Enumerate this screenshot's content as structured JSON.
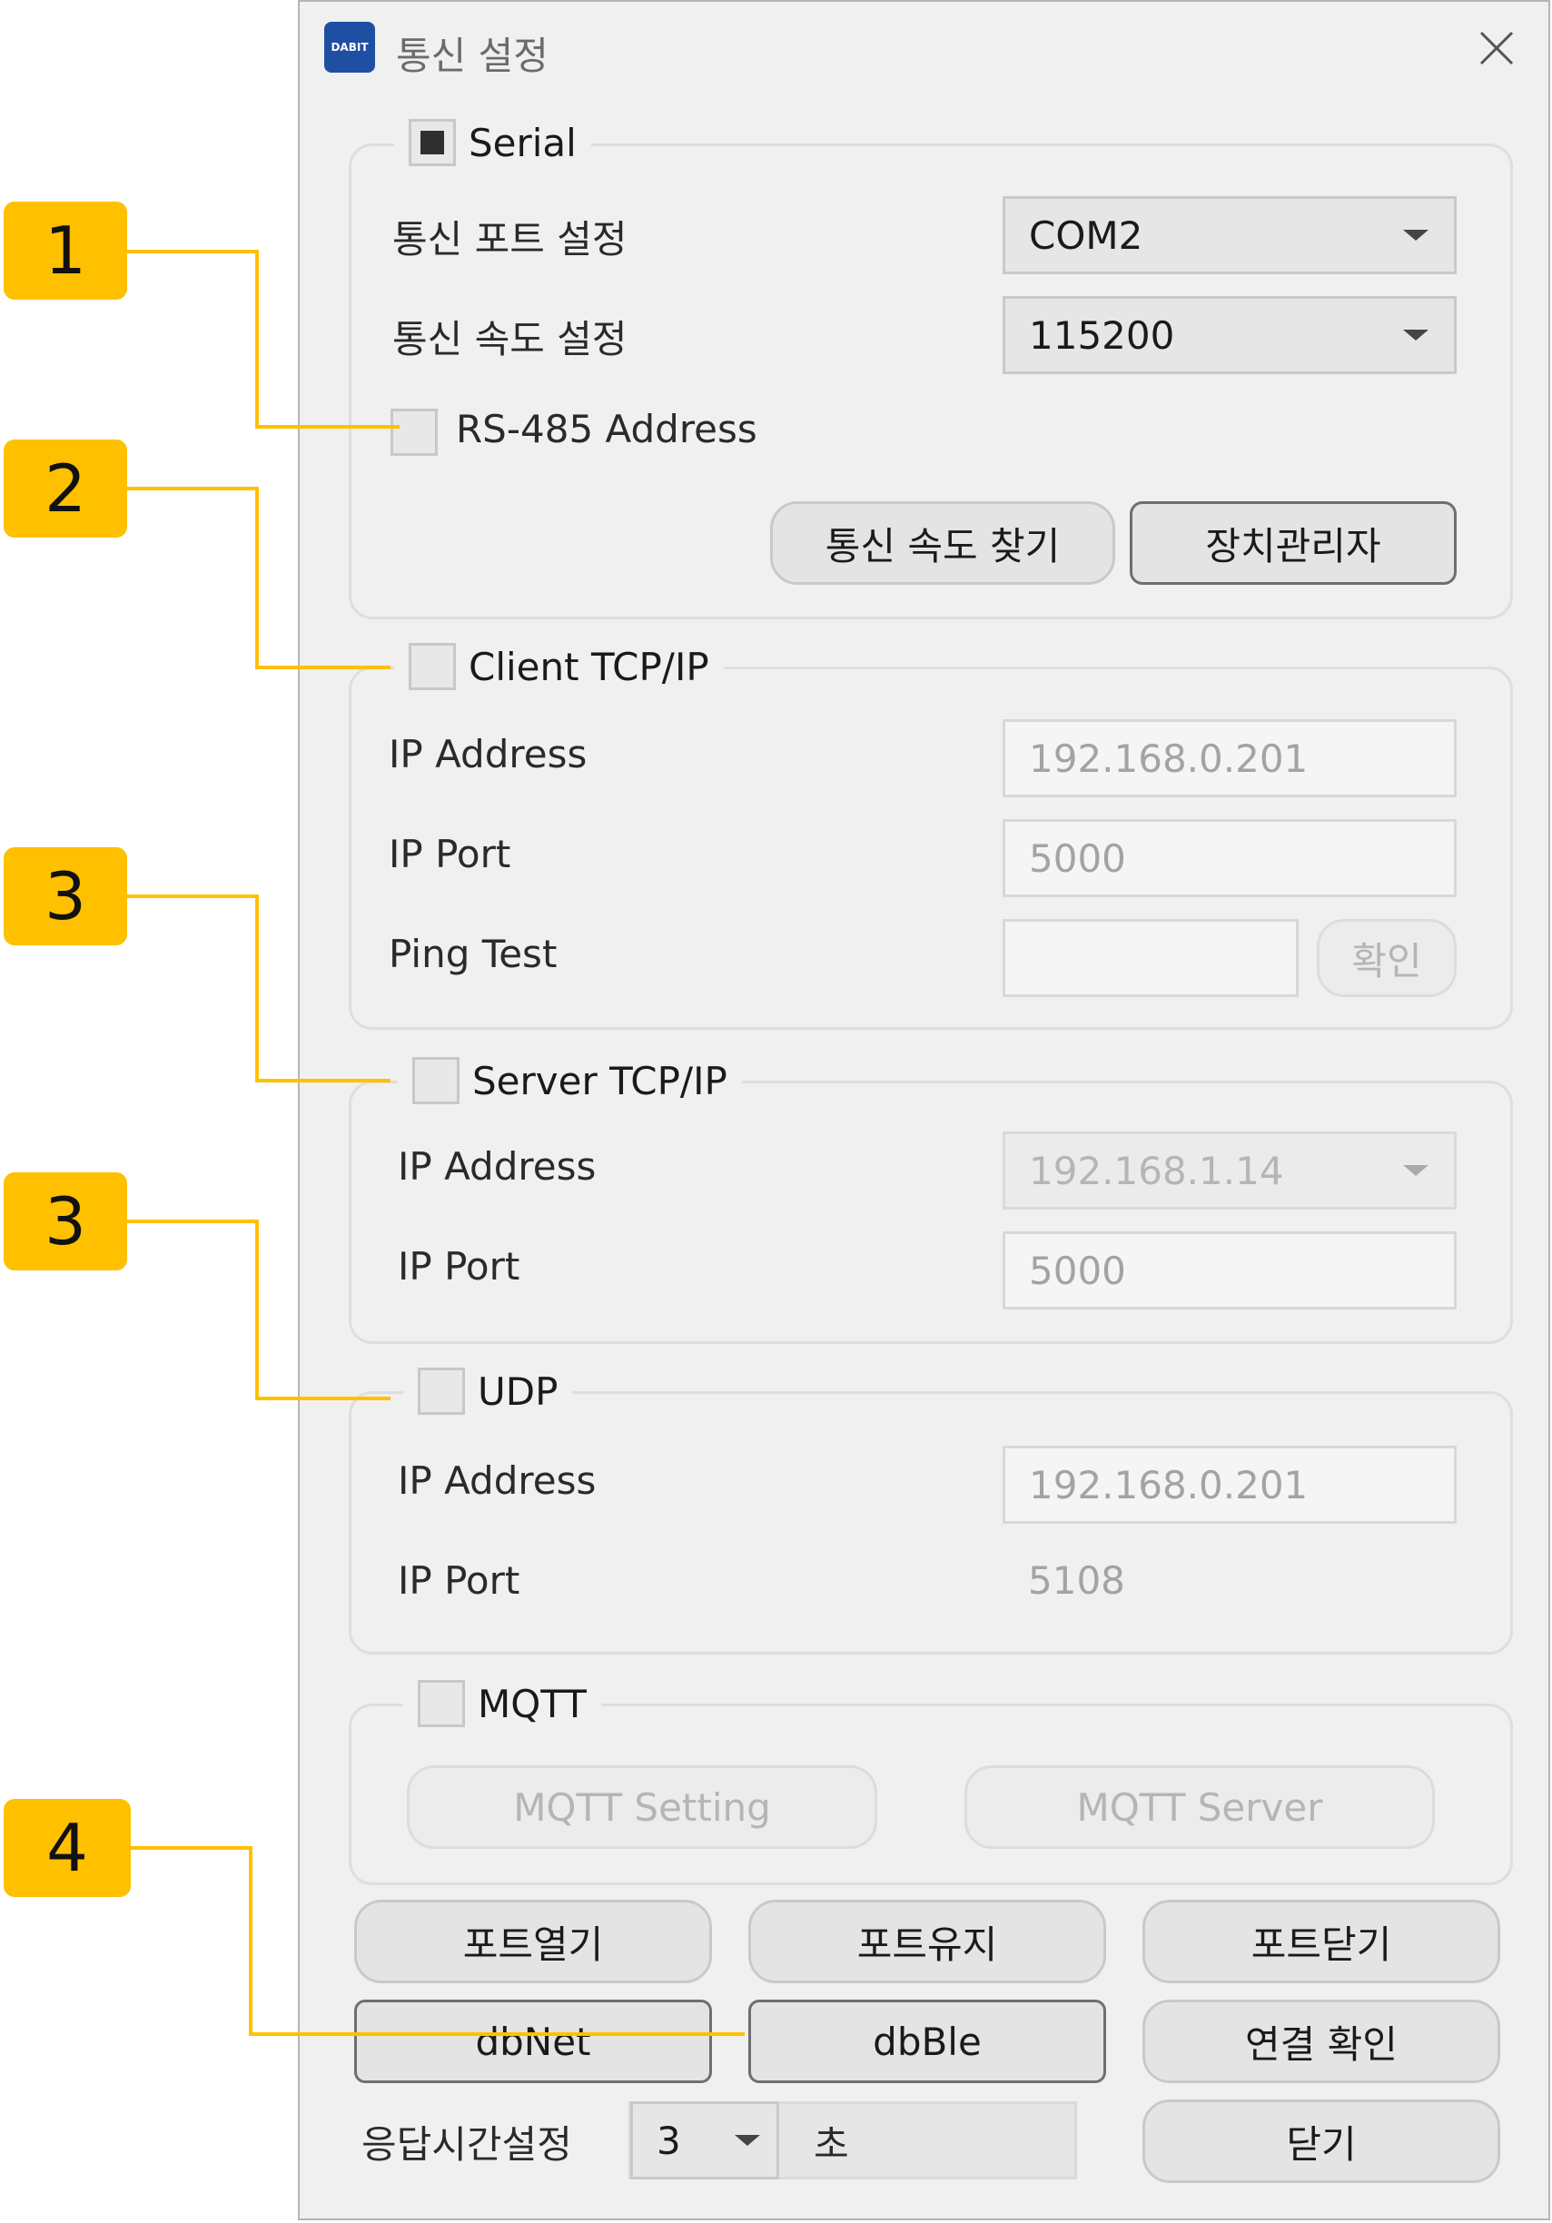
{
  "window": {
    "title": "통신 설정",
    "icon_text": "DABIT"
  },
  "serial": {
    "title": "Serial",
    "checked": true,
    "port_label": "통신 포트 설정",
    "port_value": "COM2",
    "baud_label": "통신 속도 설정",
    "baud_value": "115200",
    "rs485_label": "RS-485 Address",
    "find_baud_button": "통신 속도 찾기",
    "device_manager_button": "장치관리자"
  },
  "client_tcp": {
    "title": "Client TCP/IP",
    "ip_label": "IP Address",
    "ip_value": "192.168.0.201",
    "port_label": "IP Port",
    "port_value": "5000",
    "ping_label": "Ping Test",
    "ping_value": "",
    "confirm_button": "확인"
  },
  "server_tcp": {
    "title": "Server TCP/IP",
    "ip_label": "IP Address",
    "ip_value": "192.168.1.14",
    "port_label": "IP Port",
    "port_value": "5000"
  },
  "udp": {
    "title": "UDP",
    "ip_label": "IP Address",
    "ip_value": "192.168.0.201",
    "port_label": "IP Port",
    "port_value": "5108"
  },
  "mqtt": {
    "title": "MQTT",
    "setting_button": "MQTT Setting",
    "server_button": "MQTT Server"
  },
  "actions": {
    "open_port": "포트열기",
    "keep_port": "포트유지",
    "close_port": "포트닫기",
    "dbnet": "dbNet",
    "dbble": "dbBle",
    "check_connection": "연결 확인",
    "close": "닫기"
  },
  "response": {
    "label": "응답시간설정",
    "value": "3",
    "unit": "초"
  },
  "callouts": [
    "1",
    "2",
    "3",
    "3",
    "4"
  ],
  "colors": {
    "callout": "#ffc000",
    "dialog_bg": "#f0f0f0"
  }
}
